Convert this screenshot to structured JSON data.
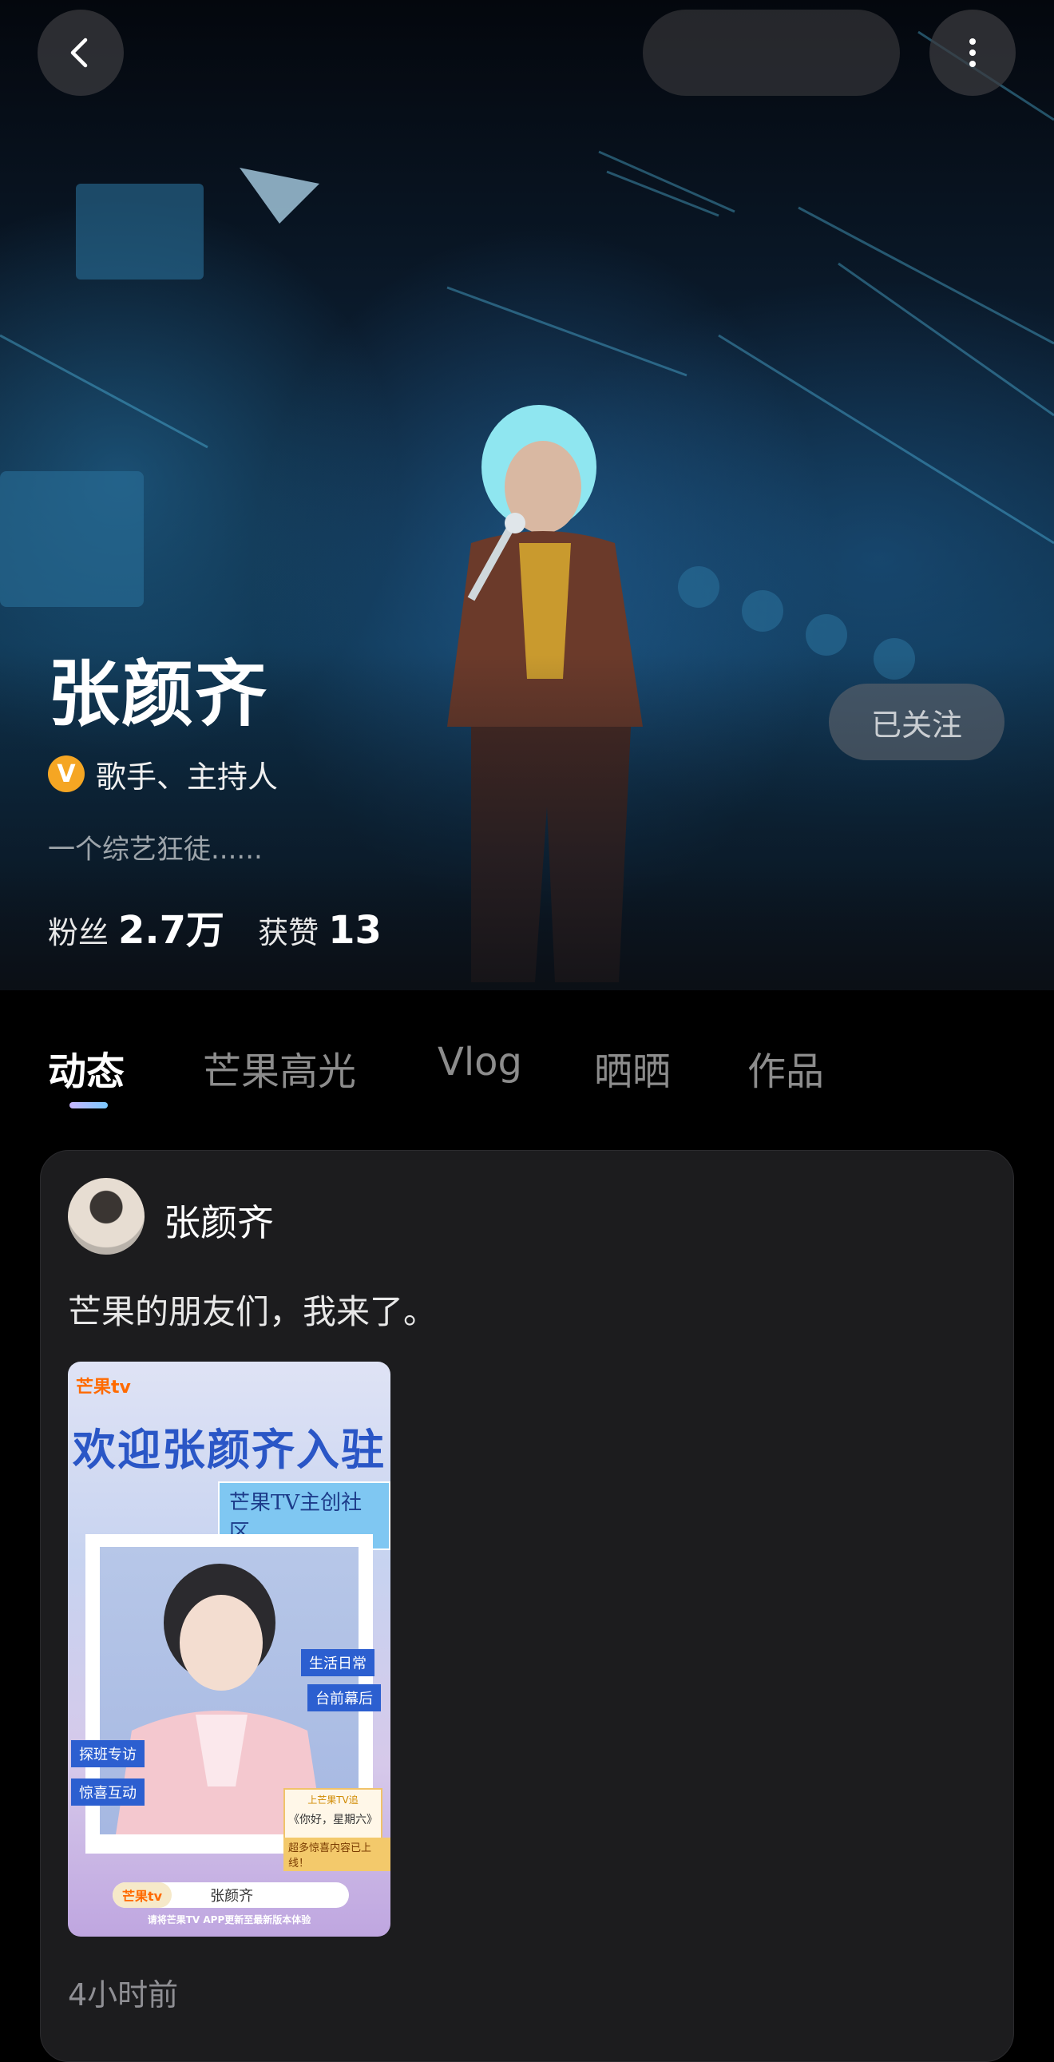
{
  "header": {
    "back_icon": "chevron-left-icon",
    "more_icon": "more-vertical-icon"
  },
  "profile": {
    "name": "张颜齐",
    "verified_badge": "V",
    "role": "歌手、主持人",
    "bio": "一个综艺狂徒......",
    "fans_label": "粉丝",
    "fans_value": "2.7万",
    "likes_label": "获赞",
    "likes_value": "13",
    "follow_label": "已关注"
  },
  "tabs": [
    {
      "label": "动态",
      "active": true
    },
    {
      "label": "芒果高光",
      "active": false
    },
    {
      "label": "Vlog",
      "active": false
    },
    {
      "label": "晒晒",
      "active": false
    },
    {
      "label": "作品",
      "active": false
    }
  ],
  "post": {
    "author": "张颜齐",
    "text": "芒果的朋友们，我来了。",
    "timestamp": "4小时前",
    "image": {
      "logo": "芒果tv",
      "headline": "欢迎张颜齐入驻",
      "subheadline": "芒果TV主创社区",
      "tags": [
        "生活日常",
        "台前幕后",
        "探班专访",
        "惊喜互动"
      ],
      "promo_small": "上芒果TV追",
      "promo_show": "《你好，星期六》",
      "promo_more": "超多惊喜内容已上线！",
      "search_brand": "芒果tv",
      "search_text": "张颜齐",
      "footer": "请将芒果TV APP更新至最新版本体验"
    }
  },
  "colors": {
    "accent_badge": "#f5a623",
    "tab_indicator_start": "#c9b6ff",
    "tab_indicator_end": "#7ac9ff",
    "card_bg": "#1c1c1e"
  }
}
